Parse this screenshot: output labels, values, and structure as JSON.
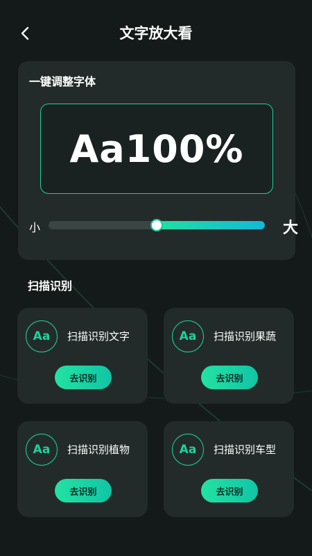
{
  "header": {
    "title": "文字放大看",
    "back_icon": "chevron-left-icon"
  },
  "font_adjust": {
    "label": "一键调整字体",
    "preview_text": "Aa100%",
    "slider": {
      "min_label": "小",
      "max_label": "大",
      "value_percent": 50
    }
  },
  "scan": {
    "title": "扫描识别",
    "items": [
      {
        "icon_text": "Aa",
        "label": "扫描识别文字",
        "button": "去识别"
      },
      {
        "icon_text": "Aa",
        "label": "扫描识别果蔬",
        "button": "去识别"
      },
      {
        "icon_text": "Aa",
        "label": "扫描识别植物",
        "button": "去识别"
      },
      {
        "icon_text": "Aa",
        "label": "扫描识别车型",
        "button": "去识别"
      }
    ]
  },
  "colors": {
    "background": "#141a19",
    "card": "#232b2a",
    "accent": "#1fd19a",
    "accent_blue": "#14b8d8"
  }
}
